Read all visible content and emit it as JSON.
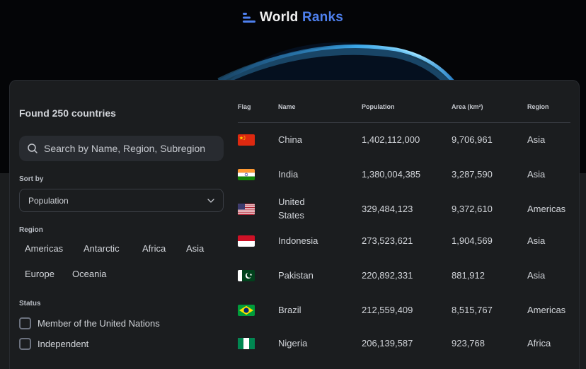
{
  "app": {
    "logo_word1": "World",
    "logo_word2": "Ranks",
    "accent_color": "#4e80ee"
  },
  "sidebar": {
    "found_text": "Found 250 countries",
    "search_placeholder": "Search by Name, Region, Subregion",
    "sort_label": "Sort by",
    "sort_value": "Population",
    "region_label": "Region",
    "regions": [
      "Americas",
      "Antarctic",
      "Africa",
      "Asia",
      "Europe",
      "Oceania"
    ],
    "status_label": "Status",
    "status_options": [
      "Member of the United Nations",
      "Independent"
    ]
  },
  "table": {
    "headers": [
      "Flag",
      "Name",
      "Population",
      "Area (km²)",
      "Region"
    ],
    "rows": [
      {
        "flag": "china-flag",
        "name": "China",
        "population": "1,402,112,000",
        "area": "9,706,961",
        "region": "Asia"
      },
      {
        "flag": "india-flag",
        "name": "India",
        "population": "1,380,004,385",
        "area": "3,287,590",
        "region": "Asia"
      },
      {
        "flag": "usa-flag",
        "name_line1": "United",
        "name_line2": "States",
        "population": "329,484,123",
        "area": "9,372,610",
        "region": "Americas"
      },
      {
        "flag": "indonesia-flag",
        "name": "Indonesia",
        "population": "273,523,621",
        "area": "1,904,569",
        "region": "Asia"
      },
      {
        "flag": "pakistan-flag",
        "name": "Pakistan",
        "population": "220,892,331",
        "area": "881,912",
        "region": "Asia"
      },
      {
        "flag": "brazil-flag",
        "name": "Brazil",
        "population": "212,559,409",
        "area": "8,515,767",
        "region": "Americas"
      },
      {
        "flag": "nigeria-flag",
        "name": "Nigeria",
        "population": "206,139,587",
        "area": "923,768",
        "region": "Africa"
      }
    ]
  }
}
